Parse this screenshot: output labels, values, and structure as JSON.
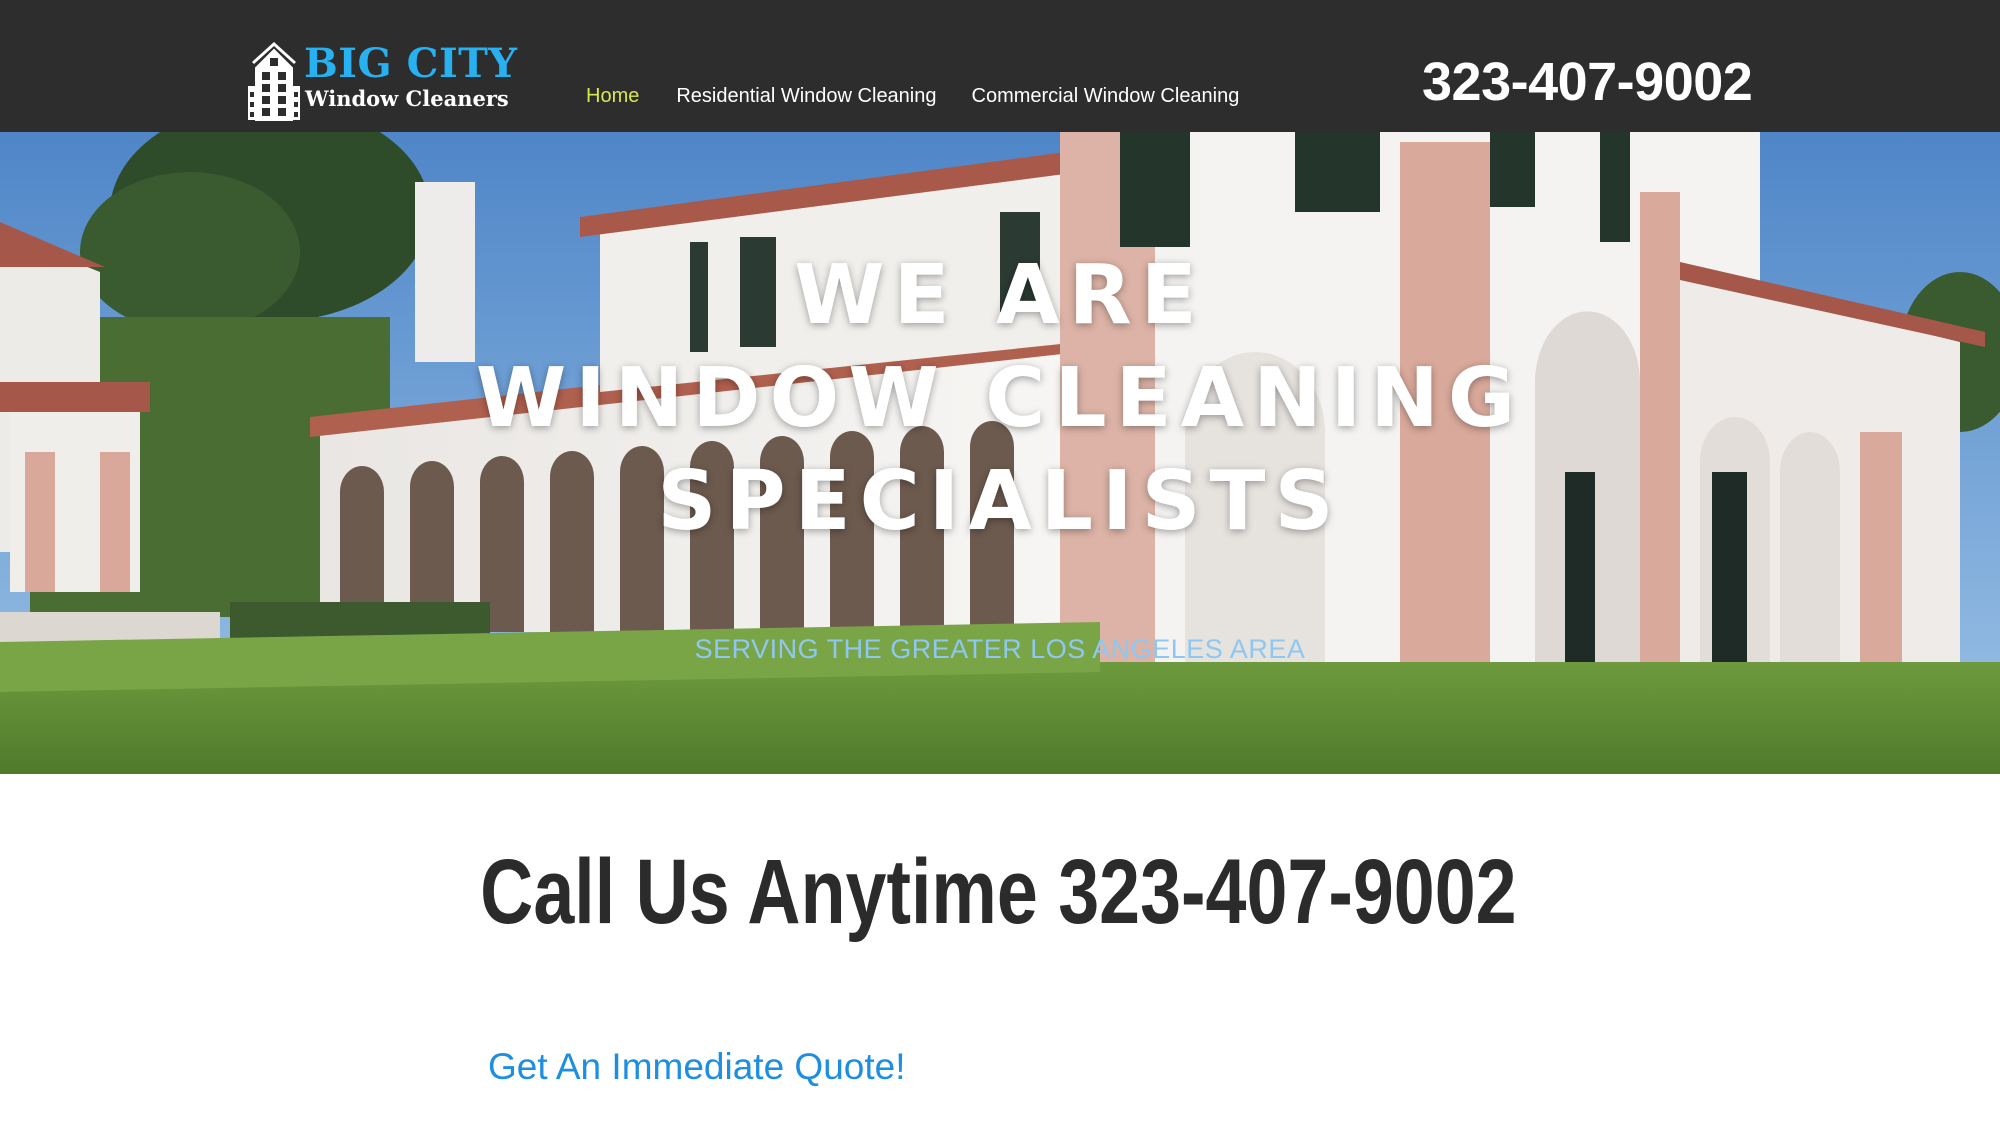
{
  "header": {
    "logo": {
      "title": "BIG CITY",
      "subtitle": "Window Cleaners",
      "icon": "building-icon"
    },
    "nav": {
      "items": [
        {
          "label": "Home",
          "active": true
        },
        {
          "label": "Residential Window Cleaning",
          "active": false
        },
        {
          "label": "Commercial Window Cleaning",
          "active": false
        }
      ]
    },
    "phone": "323-407-9002"
  },
  "hero": {
    "headline_lines": [
      "WE ARE",
      "WINDOW CLEANING",
      "SPECIALISTS"
    ],
    "subheadline": "SERVING THE GREATER LOS ANGELES AREA"
  },
  "main": {
    "call_heading": "Call Us Anytime 323-407-9002",
    "quote_link": "Get An Immediate Quote!"
  },
  "colors": {
    "header_bg": "#2d2d2d",
    "logo_blue": "#27b1f0",
    "nav_active": "#d7e84c",
    "subheadline": "#8ec8f2",
    "heading_text": "#2b2b2b",
    "link_blue": "#1e8fe0"
  }
}
